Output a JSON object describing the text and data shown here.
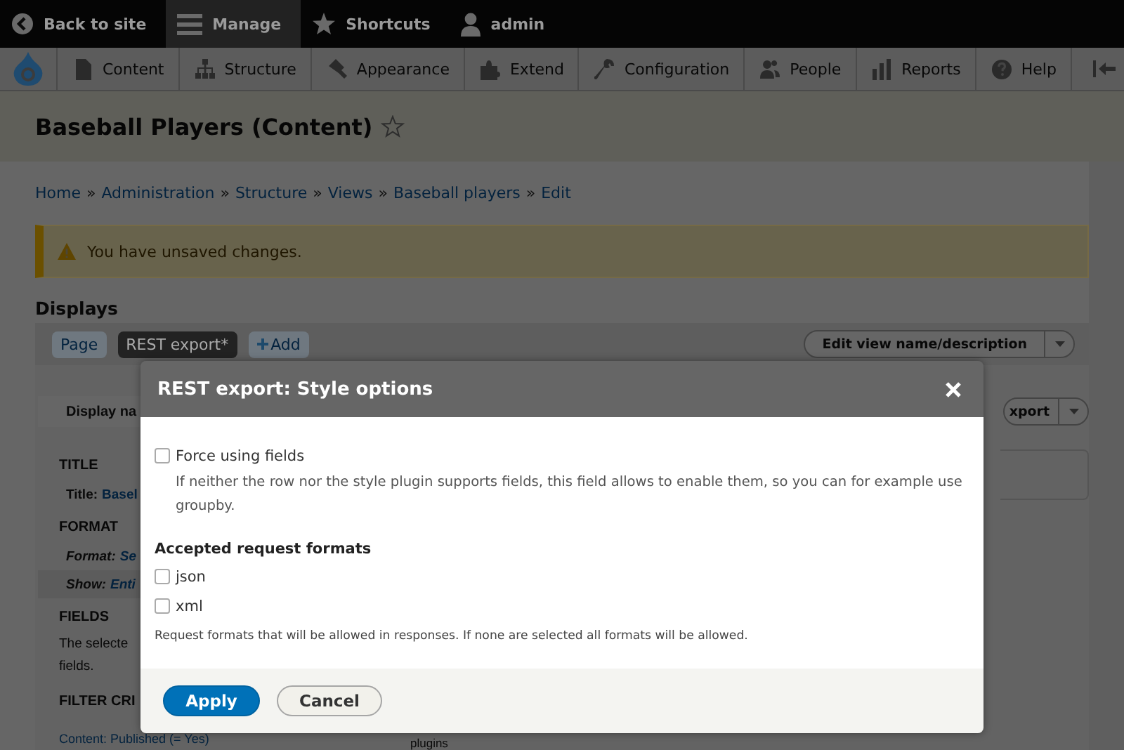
{
  "toolbar": {
    "items": [
      {
        "label": "Back to site",
        "selected": false
      },
      {
        "label": "Manage",
        "selected": true
      },
      {
        "label": "Shortcuts",
        "selected": false
      },
      {
        "label": "admin",
        "selected": false
      }
    ]
  },
  "admin_menu": {
    "items": [
      "Content",
      "Structure",
      "Appearance",
      "Extend",
      "Configuration",
      "People",
      "Reports",
      "Help"
    ]
  },
  "page": {
    "title": "Baseball Players (Content)",
    "breadcrumb": [
      "Home",
      "Administration",
      "Structure",
      "Views",
      "Baseball players",
      "Edit"
    ],
    "breadcrumb_separator": "»",
    "message": "You have unsaved changes.",
    "displays_heading": "Displays",
    "display_tabs": [
      {
        "label": "Page",
        "selected": false
      },
      {
        "label": "REST export*",
        "selected": true
      }
    ],
    "add_label": "Add",
    "edit_button": "Edit view name/description"
  },
  "display_settings": {
    "display_name": "Display na",
    "sections": [
      {
        "heading": "TITLE",
        "rows": [
          {
            "kind": "setting",
            "label": "Title:",
            "value": "Basel"
          }
        ]
      },
      {
        "heading": "FORMAT",
        "rows": [
          {
            "kind": "italic",
            "label": "Format:",
            "value": "Se"
          },
          {
            "kind": "italic",
            "label": "Show:",
            "value": "Enti"
          }
        ]
      },
      {
        "heading": "FIELDS",
        "rows": [
          {
            "kind": "text",
            "text": "The selecte"
          },
          {
            "kind": "text",
            "text": "fields."
          }
        ]
      },
      {
        "heading": "FILTER CRI",
        "rows": [
          {
            "kind": "link",
            "text": "Content: Published (= Yes)"
          }
        ]
      }
    ],
    "middle_text": "plugins",
    "export_button": "xport"
  },
  "dialog": {
    "title": "REST export: Style options",
    "force_fields": {
      "label": "Force using fields",
      "checked": false,
      "description": "If neither the row nor the style plugin supports fields, this field allows to enable them, so you can for example use groupby."
    },
    "formats": {
      "label": "Accepted request formats",
      "options": [
        {
          "label": "json",
          "checked": false
        },
        {
          "label": "xml",
          "checked": false
        }
      ],
      "description": "Request formats that will be allowed in responses. If none are selected all formats will be allowed."
    },
    "buttons": [
      {
        "label": "Apply",
        "kind": "primary"
      },
      {
        "label": "Cancel",
        "kind": "secondary"
      }
    ]
  }
}
